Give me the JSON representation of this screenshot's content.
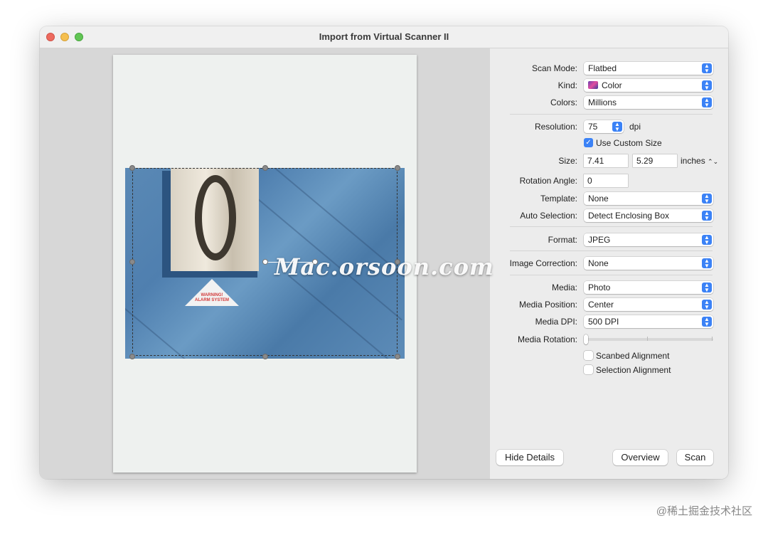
{
  "window": {
    "title": "Import from Virtual Scanner II"
  },
  "preview": {
    "watermark": "Mac.orsoon.com",
    "sign_text_1": "WARNING!",
    "sign_text_2": "ALARM SYSTEM"
  },
  "settings": {
    "scan_mode_label": "Scan Mode:",
    "scan_mode_value": "Flatbed",
    "kind_label": "Kind:",
    "kind_value": "Color",
    "colors_label": "Colors:",
    "colors_value": "Millions",
    "resolution_label": "Resolution:",
    "resolution_value": "75",
    "resolution_unit": "dpi",
    "use_custom_size_label": "Use Custom Size",
    "use_custom_size_checked": true,
    "size_label": "Size:",
    "size_width": "7.41",
    "size_height": "5.29",
    "size_unit": "inches",
    "rotation_label": "Rotation Angle:",
    "rotation_value": "0",
    "template_label": "Template:",
    "template_value": "None",
    "auto_selection_label": "Auto Selection:",
    "auto_selection_value": "Detect Enclosing Box",
    "format_label": "Format:",
    "format_value": "JPEG",
    "image_correction_label": "Image Correction:",
    "image_correction_value": "None",
    "media_label": "Media:",
    "media_value": "Photo",
    "media_position_label": "Media Position:",
    "media_position_value": "Center",
    "media_dpi_label": "Media DPI:",
    "media_dpi_value": "500 DPI",
    "media_rotation_label": "Media Rotation:",
    "media_rotation_level": 0,
    "scanbed_alignment_label": "Scanbed Alignment",
    "scanbed_alignment_checked": false,
    "selection_alignment_label": "Selection Alignment",
    "selection_alignment_checked": false
  },
  "buttons": {
    "hide_details": "Hide Details",
    "overview": "Overview",
    "scan": "Scan"
  },
  "credit": "@稀土掘金技术社区"
}
